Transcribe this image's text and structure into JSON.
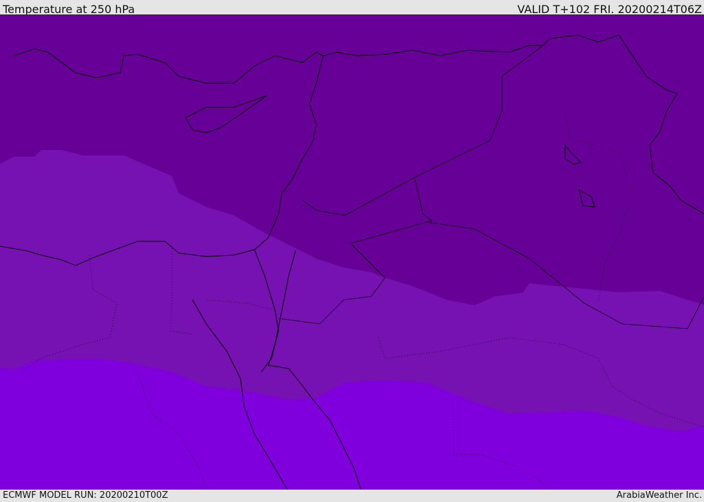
{
  "header": {
    "title": "Temperature at 250 hPa",
    "valid": "VALID T+102 FRI. 20200214T06Z"
  },
  "footer": {
    "model_run": "ECMWF MODEL RUN: 20200210T00Z",
    "credit": "ArabiaWeather Inc."
  },
  "colors": {
    "band_cold": "#660096",
    "band_mid": "#7712b2",
    "band_warm": "#7f00dc",
    "background": "#e5e5e5",
    "coast": "#000000"
  }
}
